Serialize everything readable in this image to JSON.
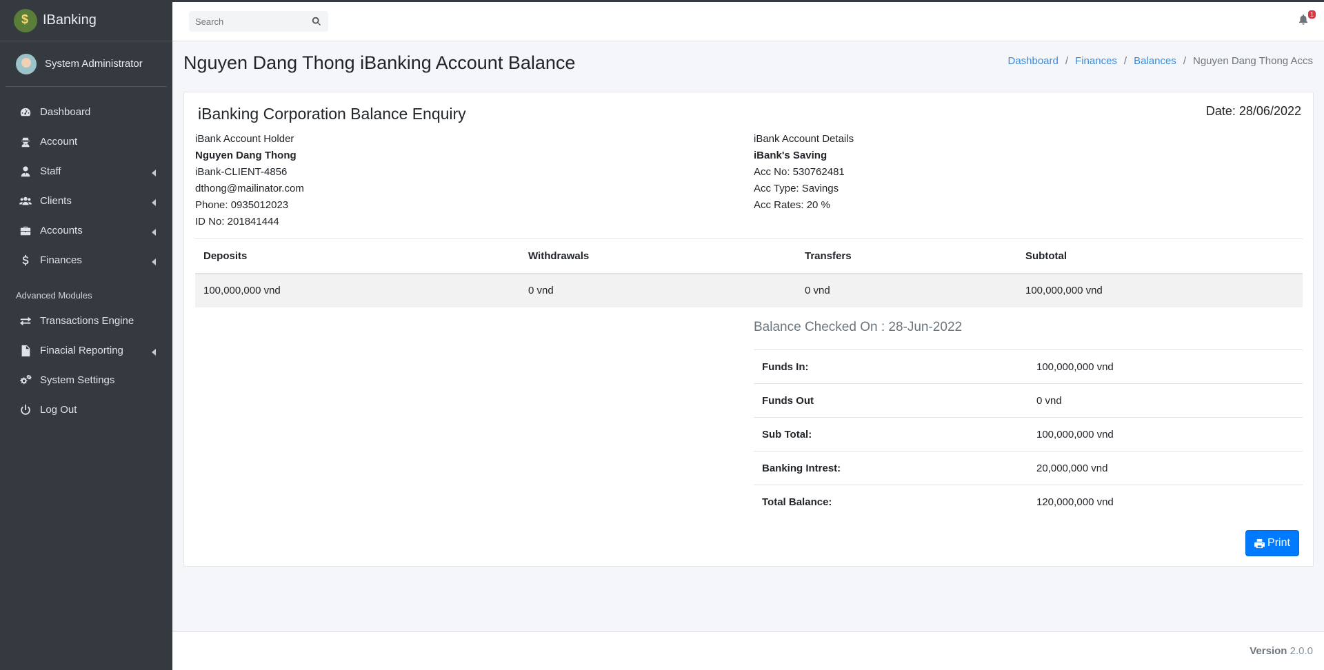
{
  "app": {
    "brand": "IBanking"
  },
  "user": {
    "name": "System Administrator"
  },
  "sidebar": {
    "items": [
      {
        "label": "Dashboard",
        "icon": "tachometer-icon"
      },
      {
        "label": "Account",
        "icon": "user-secret-icon"
      },
      {
        "label": "Staff",
        "icon": "user-tie-icon"
      },
      {
        "label": "Clients",
        "icon": "users-icon"
      },
      {
        "label": "Accounts",
        "icon": "briefcase-icon"
      },
      {
        "label": "Finances",
        "icon": "dollar-icon"
      }
    ],
    "section_header": "Advanced Modules",
    "advanced": [
      {
        "label": "Transactions Engine",
        "icon": "exchange-icon"
      },
      {
        "label": "Finacial Reporting",
        "icon": "file-invoice-icon"
      },
      {
        "label": "System Settings",
        "icon": "cogs-icon"
      },
      {
        "label": "Log Out",
        "icon": "power-icon"
      }
    ]
  },
  "header": {
    "search_placeholder": "Search",
    "notifications_count": "1"
  },
  "page": {
    "title": "Nguyen Dang Thong iBanking Account Balance",
    "breadcrumb": [
      "Dashboard",
      "Finances",
      "Balances",
      "Nguyen Dang Thong Accs"
    ]
  },
  "card": {
    "title": "iBanking Corporation Balance Enquiry",
    "date": "Date: 28/06/2022",
    "holder": {
      "heading": "iBank Account Holder",
      "name": "Nguyen Dang Thong",
      "client_id": "iBank-CLIENT-4856",
      "email": "dthong@mailinator.com",
      "phone": "Phone: 0935012023",
      "id_no": "ID No: 201841444"
    },
    "account": {
      "heading": "iBank Account Details",
      "name": "iBank's Saving",
      "acc_no": "Acc No: 530762481",
      "acc_type": "Acc Type: Savings",
      "acc_rates": "Acc Rates: 20 %"
    },
    "summary": {
      "headers": [
        "Deposits",
        "Withdrawals",
        "Transfers",
        "Subtotal"
      ],
      "row": [
        "100,000,000 vnd",
        "0 vnd",
        "0 vnd",
        "100,000,000 vnd"
      ]
    },
    "balance_checked": "Balance Checked On : 28-Jun-2022",
    "balance_rows": [
      {
        "label": "Funds In:",
        "value": "100,000,000 vnd"
      },
      {
        "label": "Funds Out",
        "value": "0 vnd"
      },
      {
        "label": "Sub Total:",
        "value": "100,000,000 vnd"
      },
      {
        "label": "Banking Intrest:",
        "value": "20,000,000 vnd"
      },
      {
        "label": "Total Balance:",
        "value": "120,000,000 vnd"
      }
    ],
    "print_label": "Print"
  },
  "footer": {
    "version_label": "Version",
    "version": "2.0.0"
  }
}
